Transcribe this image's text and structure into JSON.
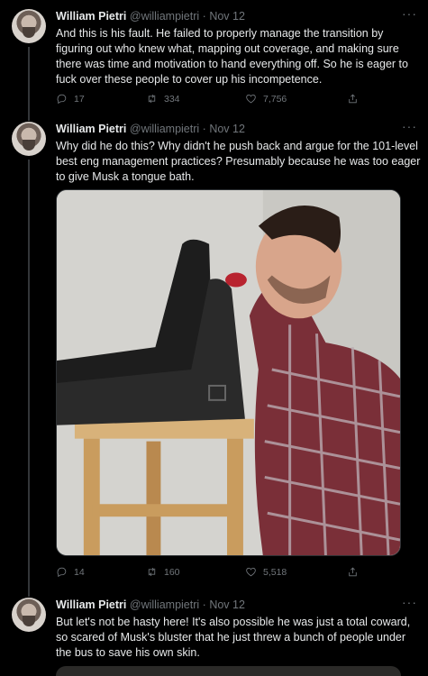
{
  "author": {
    "name": "William Pietri",
    "handle": "@williampietri",
    "date": "Nov 12",
    "separator": "·"
  },
  "tweets": [
    {
      "text": "And this is his fault. He failed to properly manage the transition by figuring out who knew what, mapping out coverage, and making sure there was time and motivation to hand everything off. So he is eager to fuck over these people to cover up his incompetence.",
      "replies": "17",
      "retweets": "334",
      "likes": "7,756"
    },
    {
      "text": "Why did he do this? Why didn't he push back and argue for the 101-level best eng management practices? Presumably because he was too eager to give Musk a tongue bath.",
      "replies": "14",
      "retweets": "160",
      "likes": "5,518"
    },
    {
      "text": "But let's not be hasty here! It's also possible he was just a total coward, so scared of Musk's bluster that he just threw a bunch of people under the bus to save his own skin."
    }
  ],
  "icons": {
    "more": "more-horizontal-icon",
    "reply": "reply-icon",
    "retweet": "retweet-icon",
    "like": "heart-icon",
    "share": "share-icon"
  },
  "colors": {
    "background": "#000000",
    "text": "#e7e9ea",
    "muted": "#71767b",
    "thread_line": "#333639"
  }
}
